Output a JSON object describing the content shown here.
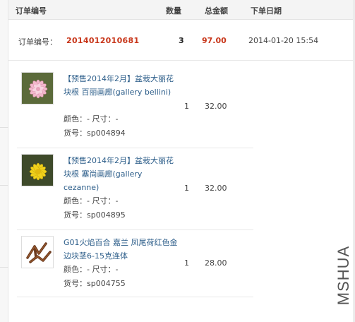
{
  "table_header": {
    "order_no": "订单编号",
    "qty": "数量",
    "total": "总金额",
    "date": "下单日期"
  },
  "order": {
    "label": "订单编号：",
    "number": "2014012010681",
    "qty": "3",
    "total": "97.00",
    "date": "2014-01-20 15:54"
  },
  "items": [
    {
      "name": "【预售2014年2月】盆栽大丽花块根 百丽画廊(gallery bellini)",
      "attrs": "颜色：- 尺寸：-",
      "sku": "货号：sp004894",
      "qty": "1",
      "price": "32.00",
      "thumb_icon": "pink-dahlia-icon"
    },
    {
      "name": "【预售2014年2月】盆栽大丽花块根 塞尚画廊(gallery cezanne)",
      "attrs": "颜色：- 尺寸：-",
      "sku": "货号：sp004895",
      "qty": "1",
      "price": "32.00",
      "thumb_icon": "yellow-dahlia-icon"
    },
    {
      "name": "G01火焰百合 嘉兰 凤尾荷红色金边块茎6-15克连体",
      "attrs": "颜色：- 尺寸：-",
      "sku": "货号：sp004755",
      "qty": "1",
      "price": "28.00",
      "thumb_icon": "lily-tuber-icon"
    }
  ],
  "watermark": "MSHUA"
}
